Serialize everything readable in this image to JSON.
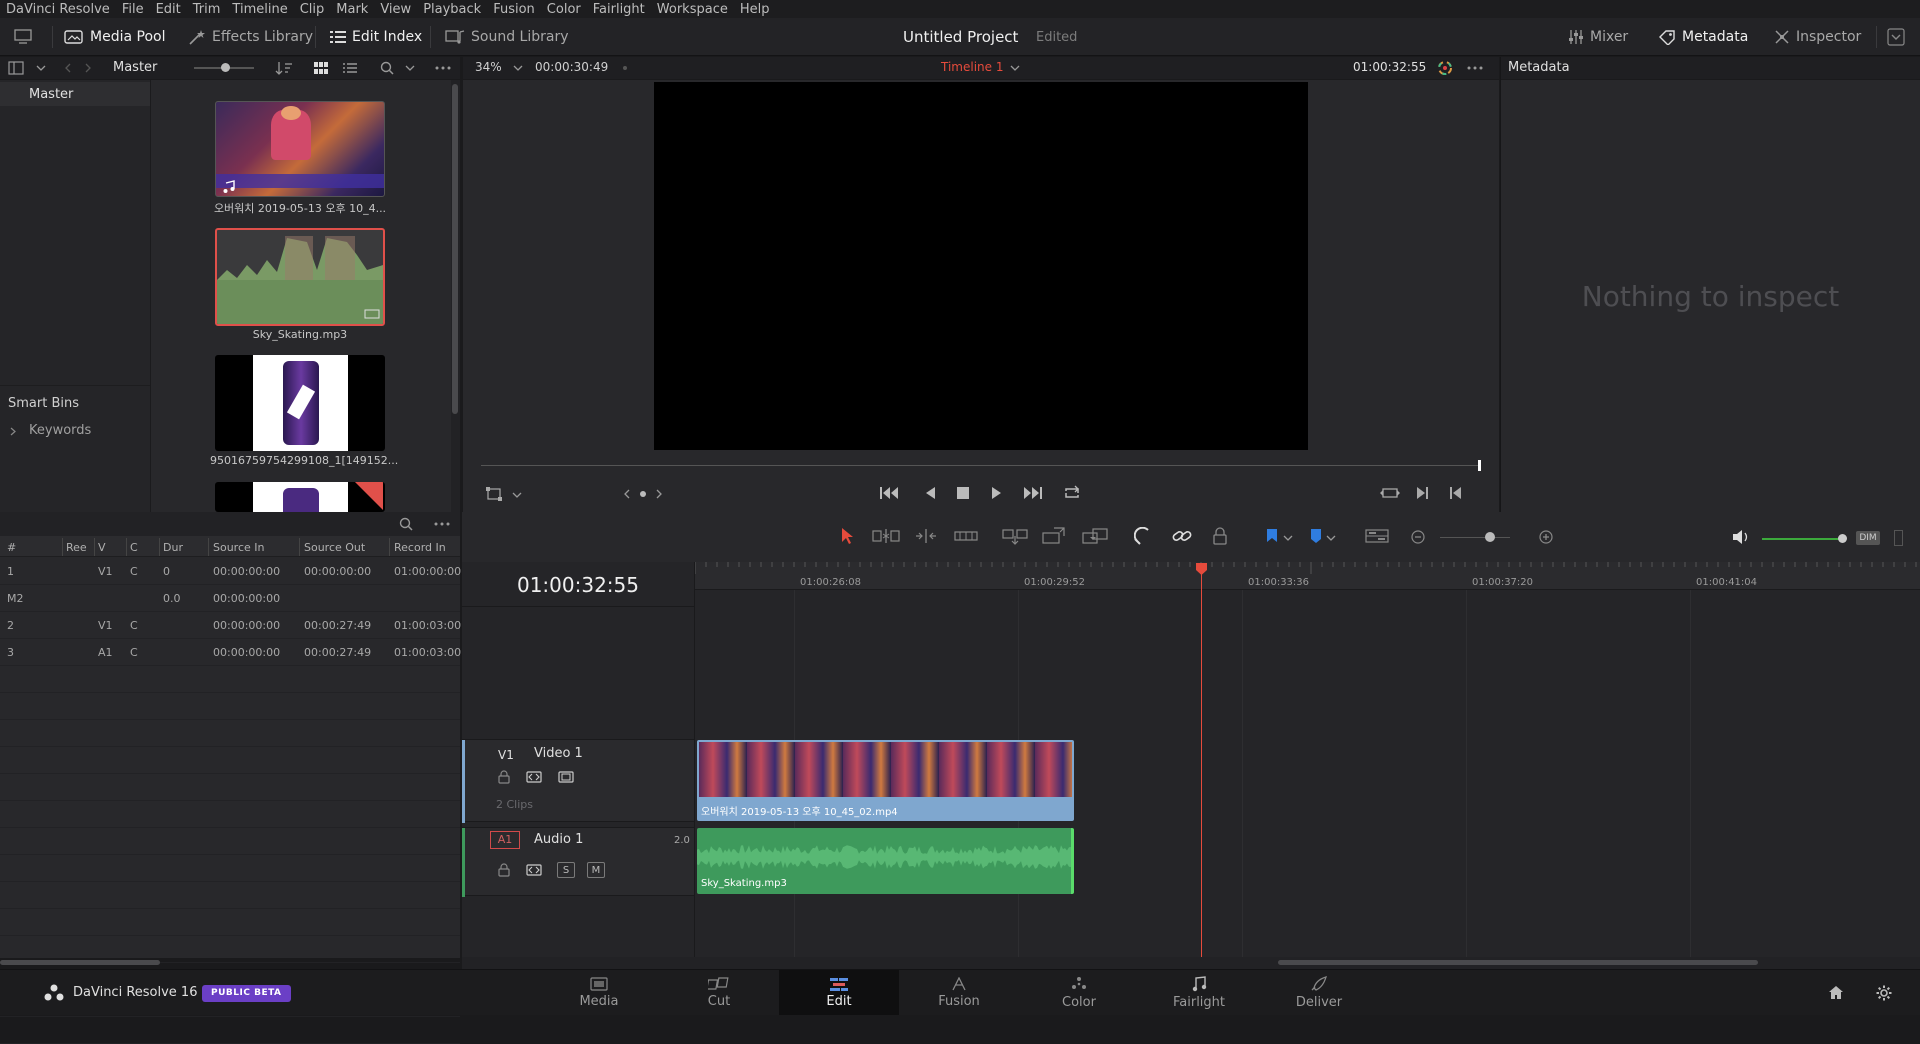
{
  "menu": [
    "DaVinci Resolve",
    "File",
    "Edit",
    "Trim",
    "Timeline",
    "Clip",
    "Mark",
    "View",
    "Playback",
    "Fusion",
    "Color",
    "Fairlight",
    "Workspace",
    "Help"
  ],
  "toolbar": {
    "media_pool": "Media Pool",
    "effects_library": "Effects Library",
    "edit_index": "Edit Index",
    "sound_library": "Sound Library",
    "project_title": "Untitled Project",
    "project_status": "Edited",
    "mixer": "Mixer",
    "metadata": "Metadata",
    "inspector": "Inspector"
  },
  "media_pool": {
    "master_label": "Master",
    "bins": [
      "Master"
    ],
    "smart_bins": "Smart Bins",
    "keywords": "Keywords",
    "clips": [
      {
        "name": "오버워치 2019-05-13 오후 10_4...",
        "type": "video"
      },
      {
        "name": "Sky_Skating.mp3",
        "type": "audio"
      },
      {
        "name": "95016759754299108_1[149152...",
        "type": "image"
      },
      {
        "name": "",
        "type": "image"
      }
    ]
  },
  "viewer": {
    "zoom": "34%",
    "source_timecode": "00:00:30:49",
    "timeline_name": "Timeline 1",
    "record_timecode": "01:00:32:55"
  },
  "metadata_panel": {
    "title": "Metadata",
    "empty_text": "Nothing to inspect"
  },
  "edit_index": {
    "columns": [
      "#",
      "Ree",
      "V",
      "C",
      "Dur",
      "Source In",
      "Source Out",
      "Record In"
    ],
    "rows": [
      [
        "1",
        "",
        "V1",
        "C",
        "0",
        "00:00:00:00",
        "00:00:00:00",
        "01:00:00:00"
      ],
      [
        "M2",
        "",
        "",
        "",
        "0.0",
        "00:00:00:00",
        "",
        ""
      ],
      [
        "2",
        "",
        "V1",
        "C",
        "",
        "00:00:00:00",
        "00:00:27:49",
        "01:00:03:00"
      ],
      [
        "3",
        "",
        "A1",
        "C",
        "",
        "00:00:00:00",
        "00:00:27:49",
        "01:00:03:00"
      ]
    ]
  },
  "timeline": {
    "timecode": "01:00:32:55",
    "ruler": [
      "01:00:26:08",
      "01:00:29:52",
      "01:00:33:36",
      "01:00:37:20",
      "01:00:41:04"
    ],
    "video_track": {
      "id": "V1",
      "name": "Video 1",
      "clips_label": "2 Clips",
      "clip_name": "오버워치 2019-05-13 오후 10_45_02.mp4"
    },
    "audio_track": {
      "id": "A1",
      "name": "Audio 1",
      "channels": "2.0",
      "clip_name": "Sky_Skating.mp3",
      "solo": "S",
      "mute": "M"
    },
    "dim_label": "DIM"
  },
  "bottom": {
    "app_name": "DaVinci Resolve 16",
    "badge": "PUBLIC BETA",
    "pages": [
      "Media",
      "Cut",
      "Edit",
      "Fusion",
      "Color",
      "Fairlight",
      "Deliver"
    ],
    "active_page": "Edit"
  },
  "colors": {
    "accent_red": "#e64b3c",
    "video_clip": "#7fa7cf",
    "audio_clip": "#3e9a5c",
    "badge": "#6b3fc6"
  }
}
